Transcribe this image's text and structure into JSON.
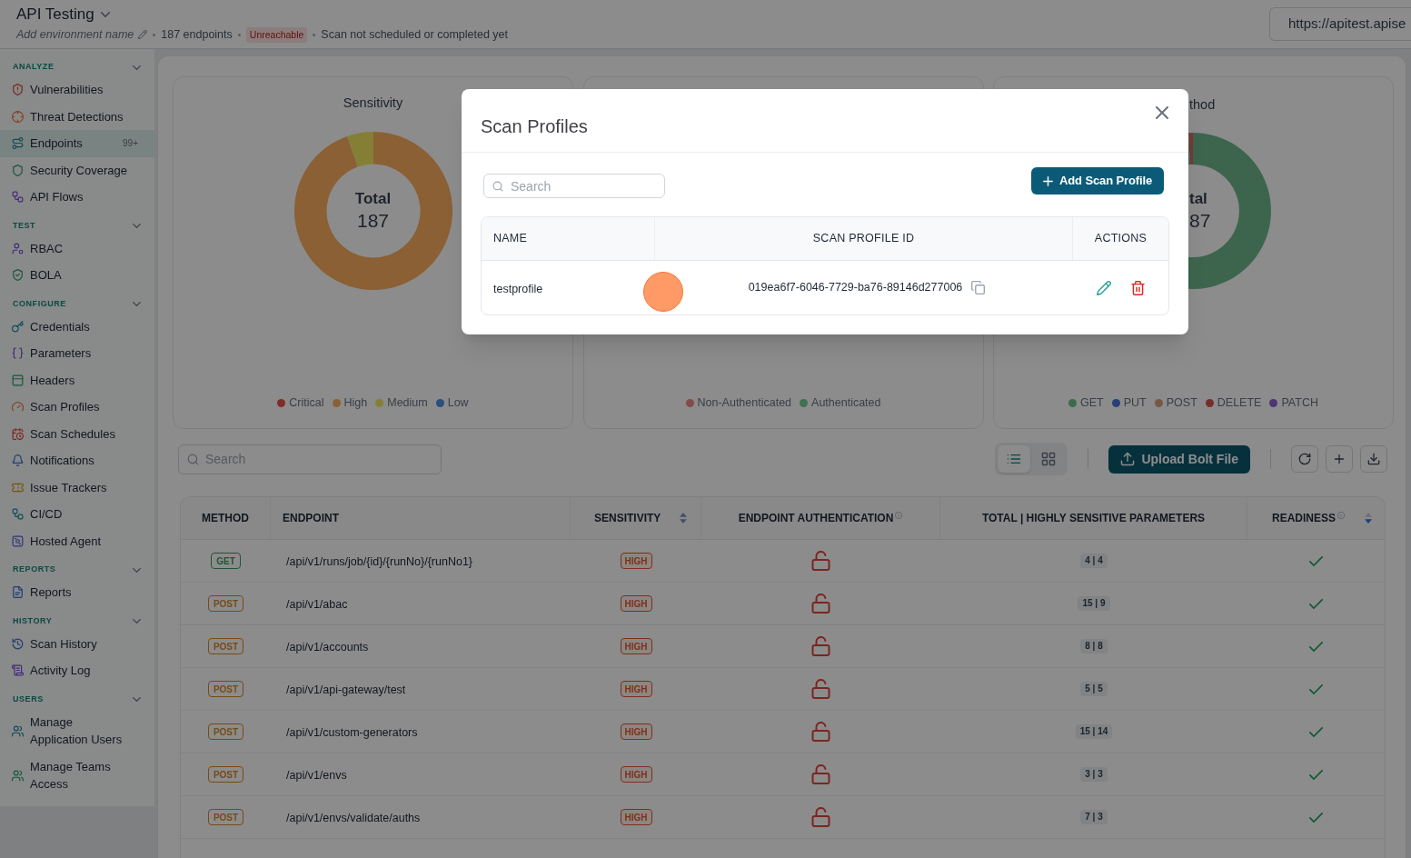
{
  "header": {
    "title": "API Testing",
    "environment_placeholder": "Add environment name",
    "endpoint_count": "187 endpoints",
    "status_badge": "Unreachable",
    "scan_status": "Scan not scheduled or completed yet",
    "url": "https://apitest.apise"
  },
  "sidebar": {
    "sections": [
      {
        "heading": "ANALYZE",
        "expanded": true,
        "items": [
          {
            "label": "Vulnerabilities",
            "selected": false
          },
          {
            "label": "Threat Detections",
            "selected": false
          },
          {
            "label": "Endpoints",
            "selected": true,
            "count": "99+"
          },
          {
            "label": "Security Coverage",
            "selected": false
          },
          {
            "label": "API Flows",
            "selected": false
          }
        ]
      },
      {
        "heading": "TEST",
        "expanded": true,
        "items": [
          {
            "label": "RBAC",
            "selected": false
          },
          {
            "label": "BOLA",
            "selected": false
          }
        ]
      },
      {
        "heading": "CONFIGURE",
        "expanded": true,
        "items": [
          {
            "label": "Credentials",
            "selected": false
          },
          {
            "label": "Parameters",
            "selected": false
          },
          {
            "label": "Headers",
            "selected": false
          },
          {
            "label": "Scan Profiles",
            "selected": false
          },
          {
            "label": "Scan Schedules",
            "selected": false
          },
          {
            "label": "Notifications",
            "selected": false
          },
          {
            "label": "Issue Trackers",
            "selected": false
          },
          {
            "label": "CI/CD",
            "selected": false
          },
          {
            "label": "Hosted Agent",
            "selected": false
          }
        ]
      },
      {
        "heading": "REPORTS",
        "expanded": true,
        "items": [
          {
            "label": "Reports",
            "selected": false
          }
        ]
      },
      {
        "heading": "HISTORY",
        "expanded": true,
        "items": [
          {
            "label": "Scan History",
            "selected": false
          },
          {
            "label": "Activity Log",
            "selected": false
          }
        ]
      },
      {
        "heading": "USERS",
        "expanded": true,
        "items": [
          {
            "label": "Manage Application Users",
            "selected": false
          },
          {
            "label": "Manage Teams Access",
            "selected": false
          }
        ]
      }
    ]
  },
  "charts": [
    {
      "kind": "donut",
      "center_label": "Total",
      "center_value": "187",
      "chart_data": {
        "type": "donut",
        "title": "Sensitivity",
        "categories": [
          "Critical",
          "High",
          "Medium",
          "Low"
        ],
        "values": [
          0,
          94.6,
          5.4,
          0
        ],
        "colors": [
          "#7e2e29",
          "#8a6034",
          "#857f36",
          "#2b4f7f"
        ]
      }
    },
    {
      "kind": "legend",
      "legend": [
        {
          "label": "Non-Authenticated",
          "color": "#834c4c"
        },
        {
          "label": "Authenticated",
          "color": "#3d7253"
        }
      ]
    },
    {
      "kind": "donut_right_part",
      "title": "thod",
      "center_label": "tal",
      "center_value": "87",
      "legend": [
        {
          "label": "GET",
          "color": "#3d6a4d"
        },
        {
          "label": "PUT",
          "color": "#294077"
        },
        {
          "label": "POST",
          "color": "#755944"
        },
        {
          "label": "DELETE",
          "color": "#772e2b"
        },
        {
          "label": "PATCH",
          "color": "#4c3674"
        }
      ]
    }
  ],
  "toolbar": {
    "search_placeholder": "Search",
    "views": [
      {
        "kind": "list",
        "selected": true
      },
      {
        "kind": "grid",
        "selected": false
      }
    ],
    "upload_button": "Upload Bolt File"
  },
  "table": {
    "columns": [
      {
        "label": "METHOD",
        "info": false,
        "sortable": false,
        "sorted": false
      },
      {
        "label": "ENDPOINT",
        "info": false,
        "sortable": false,
        "sorted": false
      },
      {
        "label": "SENSITIVITY",
        "info": false,
        "sortable": true,
        "sorted": false
      },
      {
        "label": "ENDPOINT AUTHENTICATION",
        "info": true,
        "sortable": false,
        "sorted": false
      },
      {
        "label": "TOTAL | HIGHLY SENSITIVE PARAMETERS",
        "info": false,
        "sortable": false,
        "sorted": false
      },
      {
        "label": "READINESS",
        "info": true,
        "sortable": true,
        "sorted": true
      }
    ],
    "rows": [
      {
        "method": {
          "label": "GET",
          "color": "#205533"
        },
        "endpoint": "/api/v1/runs/job/{id}/{runNo}/{runNo1}",
        "sensitivity": "HIGH",
        "authenticated": false,
        "parameters": "4 | 4",
        "ready": true
      },
      {
        "method": {
          "label": "POST",
          "color": "#754b17"
        },
        "endpoint": "/api/v1/abac",
        "sensitivity": "HIGH",
        "authenticated": false,
        "parameters": "15 | 9",
        "ready": true
      },
      {
        "method": {
          "label": "POST",
          "color": "#754b17"
        },
        "endpoint": "/api/v1/accounts",
        "sensitivity": "HIGH",
        "authenticated": false,
        "parameters": "8 | 8",
        "ready": true
      },
      {
        "method": {
          "label": "POST",
          "color": "#754b17"
        },
        "endpoint": "/api/v1/api-gateway/test",
        "sensitivity": "HIGH",
        "authenticated": false,
        "parameters": "5 | 5",
        "ready": true
      },
      {
        "method": {
          "label": "POST",
          "color": "#754b17"
        },
        "endpoint": "/api/v1/custom-generators",
        "sensitivity": "HIGH",
        "authenticated": false,
        "parameters": "15 | 14",
        "ready": true
      },
      {
        "method": {
          "label": "POST",
          "color": "#754b17"
        },
        "endpoint": "/api/v1/envs",
        "sensitivity": "HIGH",
        "authenticated": false,
        "parameters": "3 | 3",
        "ready": true
      },
      {
        "method": {
          "label": "POST",
          "color": "#754b17"
        },
        "endpoint": "/api/v1/envs/validate/auths",
        "sensitivity": "HIGH",
        "authenticated": false,
        "parameters": "7 | 3",
        "ready": true
      }
    ]
  },
  "modal": {
    "title": "Scan Profiles",
    "search_placeholder": "Search",
    "add_button": "Add Scan Profile",
    "columns": [
      "NAME",
      "SCAN PROFILE ID",
      "ACTIONS"
    ],
    "rows": [
      {
        "name": "testprofile",
        "profile_id": "019ea6f7-6046-7729-ba76-89146d277006"
      }
    ]
  }
}
